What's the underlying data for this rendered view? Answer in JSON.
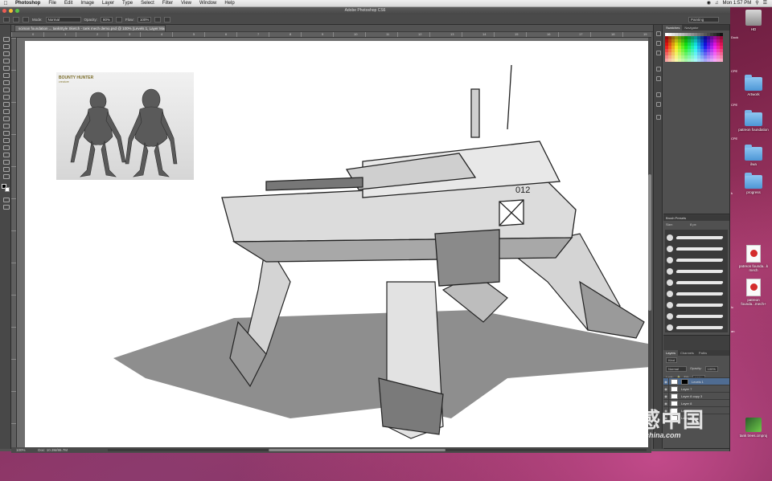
{
  "menubar": {
    "app": "Photoshop",
    "items": [
      "File",
      "Edit",
      "Image",
      "Layer",
      "Type",
      "Select",
      "Filter",
      "View",
      "Window",
      "Help"
    ],
    "clock": "Mon 1:57 PM"
  },
  "window": {
    "title": "Adobe Photoshop CS6",
    "doc_tab": "sciman foundation ... tankStyle Sketch - tank mech demo.psd @ 100% (Levels 1, Layer Mask/8) *"
  },
  "options_bar": {
    "mode_label": "Mode:",
    "mode_value": "Normal",
    "opacity_label": "Opacity:",
    "opacity_value": "80%",
    "flow_label": "Flow:",
    "flow_value": "100%",
    "workspace": "Painting"
  },
  "rulers": {
    "h_labels": [
      "0",
      "1",
      "2",
      "3",
      "4",
      "5",
      "6",
      "7",
      "8",
      "9",
      "10",
      "11",
      "12",
      "13",
      "14",
      "15",
      "16",
      "17",
      "18",
      "19"
    ]
  },
  "canvas": {
    "ref_title": "BOUNTY HUNTER",
    "ref_sub": "creature"
  },
  "statusbar": {
    "zoom": "100%",
    "doc": "Doc: 10.3M/86.7M"
  },
  "panels": {
    "swatches_tabs": [
      "Swatches",
      "Navigator"
    ],
    "brush_presets_title": "Brush Presets",
    "brush_size_label": "Size:",
    "brush_size_value": "8 px",
    "layers_tabs": [
      "Layers",
      "Channels",
      "Paths"
    ],
    "kind_label": "Kind",
    "blend_mode": "Normal",
    "opacity_label": "Opacity:",
    "opacity_value": "100%",
    "fill_label": "Fill:",
    "fill_value": "100%",
    "lock_label": "Lock:",
    "layers": [
      {
        "name": "Levels 1",
        "selected": true,
        "mask": true
      },
      {
        "name": "Layer 7",
        "selected": false,
        "mask": false
      },
      {
        "name": "Layer 8 copy 3",
        "selected": false,
        "mask": false
      },
      {
        "name": "Layer 8",
        "selected": false,
        "mask": false
      },
      {
        "name": "Layer 6",
        "selected": false,
        "mask": false
      },
      {
        "name": "Layer 5",
        "selected": false,
        "mask": false
      }
    ]
  },
  "desktop": {
    "icons": [
      {
        "name": "HD",
        "kind": "hd"
      },
      {
        "name": "Artwork",
        "kind": "folder"
      },
      {
        "name": "patreon foundation",
        "kind": "folder"
      },
      {
        "name": "ilwa",
        "kind": "folder"
      },
      {
        "name": "progress",
        "kind": "folder"
      },
      {
        "name": "patreon founda...k mech",
        "kind": "pdf"
      },
      {
        "name": "patreon founda...mech+",
        "kind": "pdf"
      },
      {
        "name": "tank trees.cmproj",
        "kind": "cmproj"
      }
    ],
    "partial_labels": [
      "Dock",
      "CPE",
      "CPE",
      "CPE",
      "k",
      "lc",
      "an"
    ]
  },
  "watermark": {
    "cn": "灵感中国",
    "url": "lingganchina.com"
  },
  "colors": {
    "ui_dark": "#535353",
    "selected_layer": "#4f6c92",
    "wallpaper": "#7a2348"
  }
}
